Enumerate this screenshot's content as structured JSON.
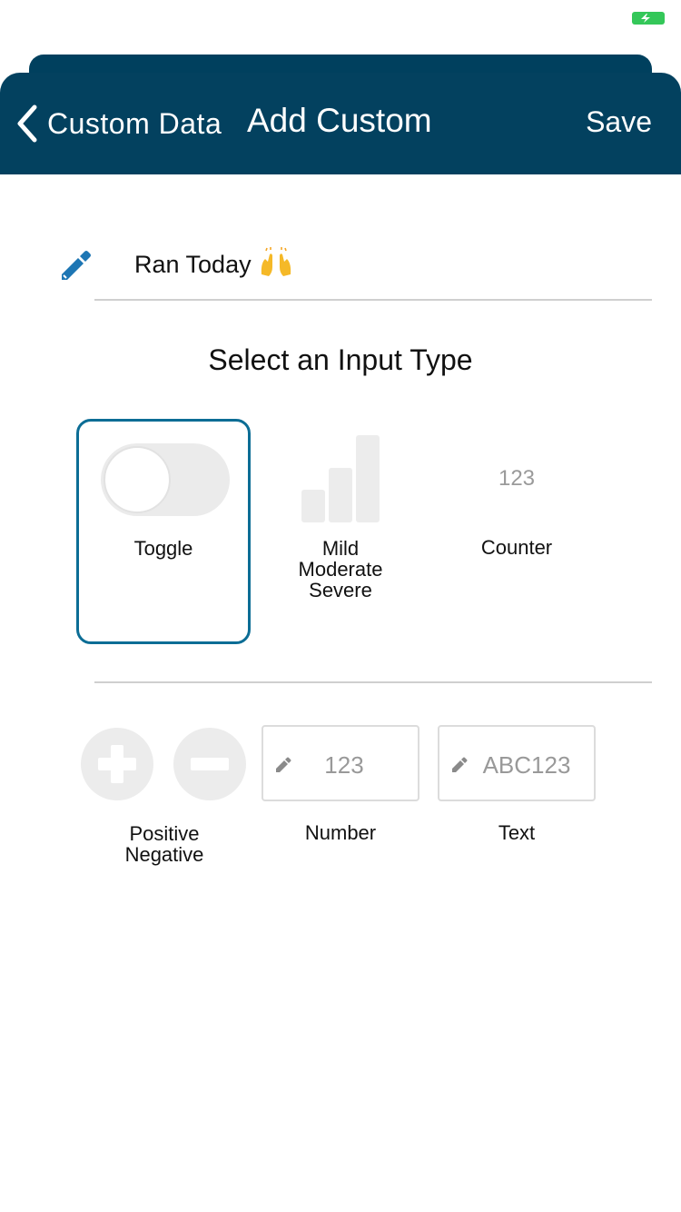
{
  "status_bar": {
    "battery_color": "#34c759"
  },
  "nav": {
    "back_label": "Custom Data",
    "title": "Add Custom",
    "save_label": "Save",
    "background_color": "#03415f",
    "back_icon": "chevron-left-icon"
  },
  "name_field": {
    "value": "Ran Today",
    "leading_icon": "pencil-icon",
    "trailing_emoji": "raised-hands-icon"
  },
  "section_title": "Select an Input Type",
  "input_types_row1": [
    {
      "label": "Toggle",
      "selected": true,
      "icon": "toggle-icon"
    },
    {
      "label_lines": [
        "Mild",
        "Moderate",
        "Severe"
      ],
      "selected": false,
      "icon": "severity-bars-icon"
    },
    {
      "label": "Counter",
      "value": "123",
      "selected": false
    }
  ],
  "input_types_row2": {
    "positive_negative": {
      "label_lines": [
        "Positive",
        "Negative"
      ],
      "icons": [
        "plus-icon",
        "minus-icon"
      ]
    },
    "number": {
      "label": "Number",
      "value": "123"
    },
    "text": {
      "label": "Text",
      "value": "ABC123"
    }
  },
  "accent_color": "#0c6d95"
}
